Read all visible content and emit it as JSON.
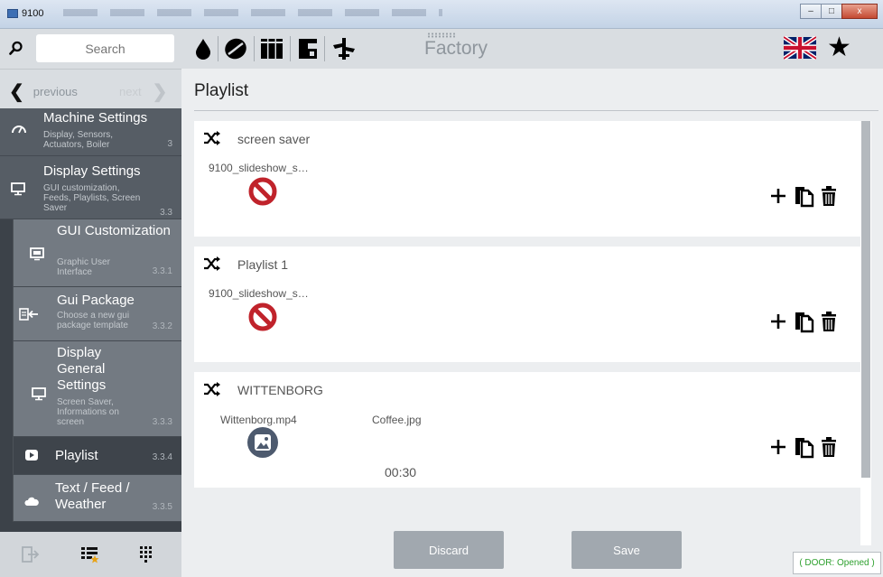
{
  "window": {
    "title": "9100",
    "min": "–",
    "max": "□",
    "close": "x"
  },
  "search": {
    "placeholder": "Search"
  },
  "nav": {
    "previous": "previous",
    "next": "next"
  },
  "menu": [
    {
      "title": "Machine Settings",
      "desc": "Display, Sensors, Actuators, Boiler",
      "num": "3",
      "icon": "gauge-icon"
    },
    {
      "title": "Display Settings",
      "desc": "GUI customization, Feeds, Playlists, Screen Saver",
      "num": "3.3",
      "icon": "monitor-icon"
    },
    {
      "title": "GUI Customization",
      "desc": "Graphic User Interface",
      "num": "3.3.1",
      "icon": "monitor-icon"
    },
    {
      "title": "Gui Package",
      "desc": "Choose a new gui package template",
      "num": "3.3.2",
      "icon": "import-icon"
    },
    {
      "title": "Display General Settings",
      "desc": "Screen Saver, Informations on screen",
      "num": "3.3.3",
      "icon": "monitor-icon"
    },
    {
      "title": "Playlist",
      "desc": "",
      "num": "3.3.4",
      "icon": "play-icon"
    },
    {
      "title": "Text / Feed / Weather",
      "desc": "",
      "num": "3.3.5",
      "icon": "cloud-icon"
    }
  ],
  "header": {
    "mode": "Factory"
  },
  "page": {
    "title": "Playlist"
  },
  "playlists": [
    {
      "name": "screen saver",
      "files": [
        "9100_slideshow_s…"
      ],
      "duration": ""
    },
    {
      "name": "Playlist 1",
      "files": [
        "9100_slideshow_s…"
      ],
      "duration": ""
    },
    {
      "name": "WITTENBORG",
      "files": [
        "Wittenborg.mp4",
        "Coffee.jpg"
      ],
      "duration": "00:30"
    }
  ],
  "buttons": {
    "discard": "Discard",
    "save": "Save"
  },
  "status": {
    "door": "( DOOR: Opened )"
  },
  "colors": {
    "sidebar": "#3c4249",
    "active": "#3e444b",
    "noentry": "#c0232b",
    "door": "#2ea02e"
  }
}
